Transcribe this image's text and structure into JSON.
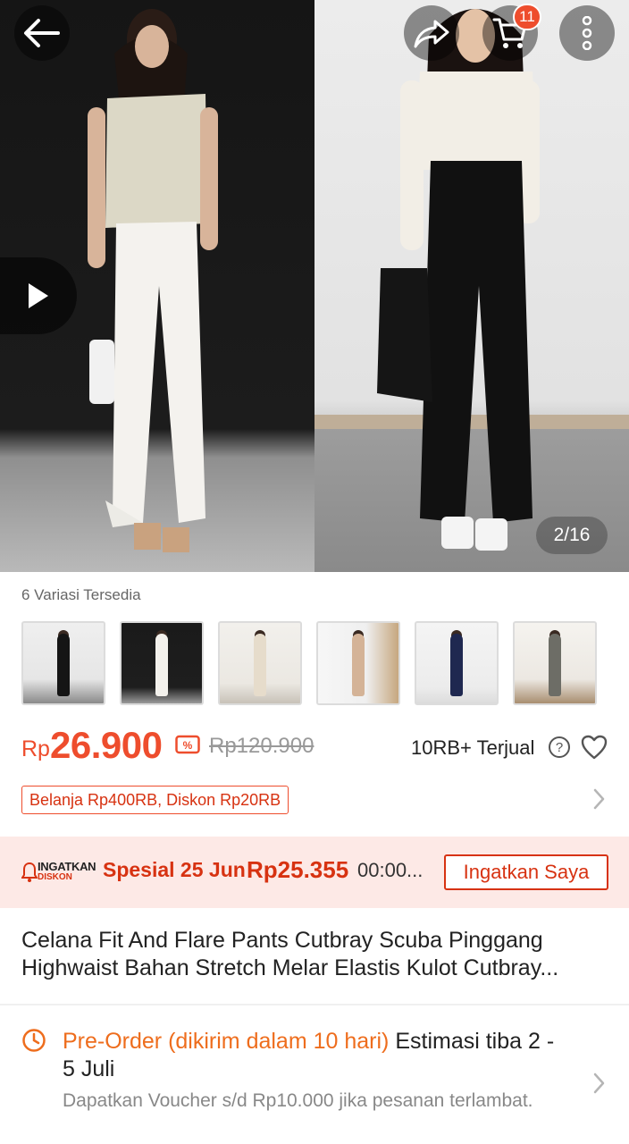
{
  "hero": {
    "page_indicator": "2/16",
    "cart_count": "11",
    "icons": [
      "back-arrow-icon",
      "share-icon",
      "cart-icon",
      "more-vertical-icon",
      "play-icon"
    ]
  },
  "variants": {
    "label": "6 Variasi Tersedia",
    "thumbs": [
      {
        "name": "black"
      },
      {
        "name": "white"
      },
      {
        "name": "cream"
      },
      {
        "name": "beige"
      },
      {
        "name": "navy"
      },
      {
        "name": "grey"
      }
    ]
  },
  "price": {
    "currency": "Rp",
    "value": "26.900",
    "old": "Rp120.900",
    "sold": "10RB+ Terjual",
    "help": "?"
  },
  "promo": {
    "tag": "Belanja Rp400RB, Diskon Rp20RB"
  },
  "flash": {
    "logo_line1": "INGATKAN",
    "logo_line2": "DISKON",
    "label": "Spesial 25 Jun",
    "price": "Rp25.355",
    "time": "00:00...",
    "button": "Ingatkan Saya"
  },
  "product": {
    "title": "Celana Fit And Flare Pants Cutbray Scuba Pinggang Highwaist Bahan Stretch Melar Elastis Kulot Cutbray..."
  },
  "shipping": {
    "preorder": "Pre-Order (dikirim dalam 10 hari)",
    "estimate": " Estimasi tiba 2 - 5 Juli",
    "voucher": "Dapatkan Voucher s/d Rp10.000 jika pesanan terlambat."
  },
  "colors": {
    "accent": "#ee4d2d",
    "flash_bg": "#fde9e6",
    "preorder": "#ee6d1d"
  }
}
